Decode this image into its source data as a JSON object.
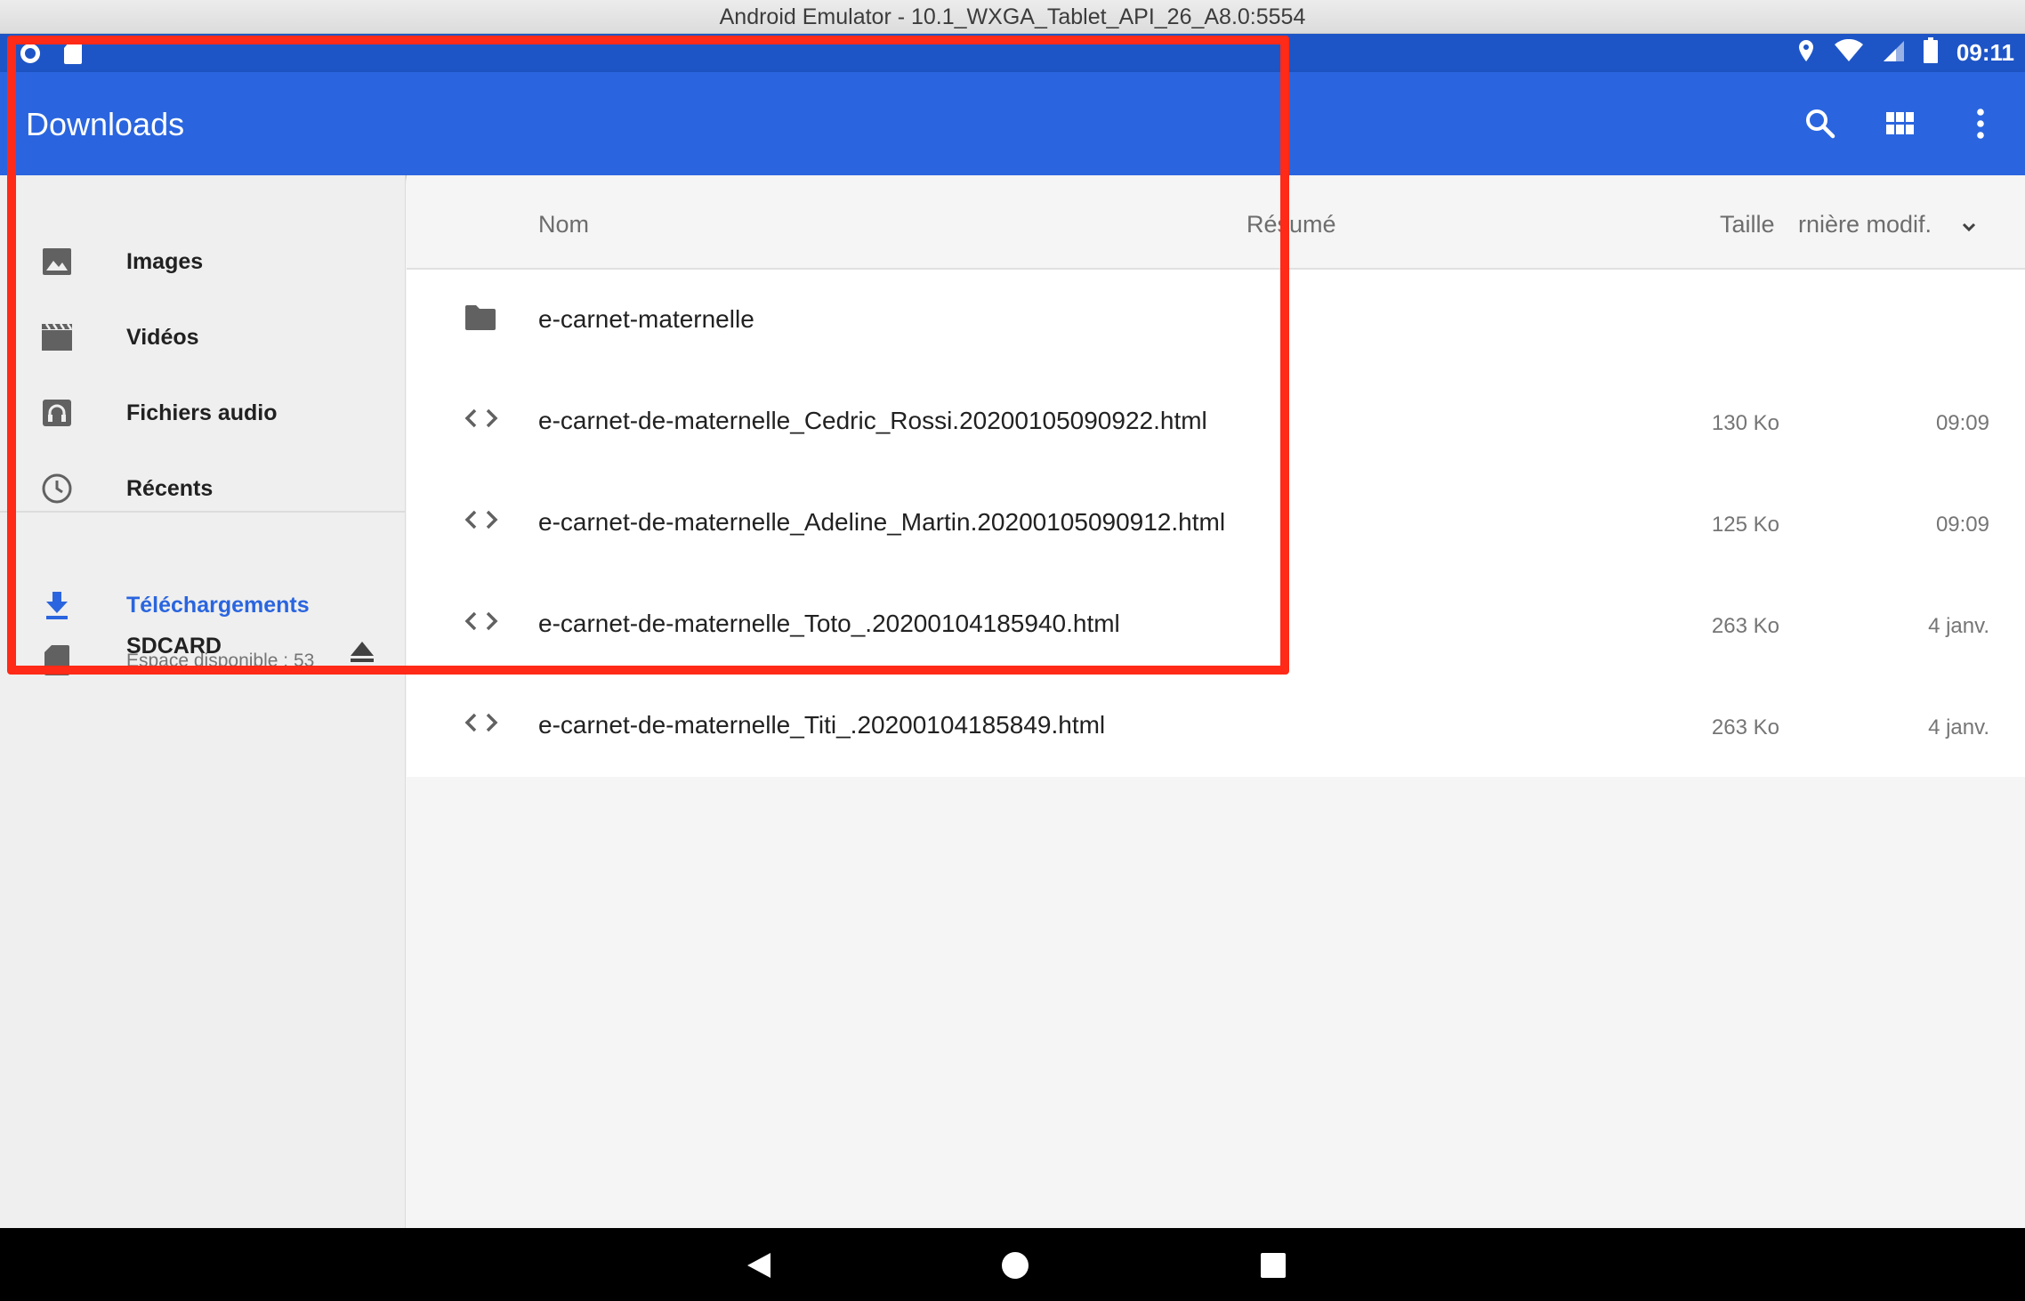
{
  "window_title": "Android Emulator - 10.1_WXGA_Tablet_API_26_A8.0:5554",
  "status_bar": {
    "time": "09:11",
    "left_icons": [
      "sync-icon",
      "sdcard-icon"
    ],
    "right_icons": [
      "location-icon",
      "wifi-icon",
      "cell-signal-icon",
      "battery-icon"
    ]
  },
  "app_bar": {
    "title": "Downloads",
    "actions": [
      "search-icon",
      "grid-view-icon",
      "more-vert-icon"
    ]
  },
  "sidebar": {
    "roots": [
      {
        "label": "Images",
        "icon": "image-icon"
      },
      {
        "label": "Vidéos",
        "icon": "video-icon"
      },
      {
        "label": "Fichiers audio",
        "icon": "headphones-icon"
      },
      {
        "label": "Récents",
        "icon": "clock-icon"
      }
    ],
    "storage": [
      {
        "label": "Téléchargements",
        "icon": "download-icon",
        "active": true
      },
      {
        "label": "SDCARD",
        "icon": "sdcard-icon",
        "subtitle": "Espace disponible : 53",
        "action_icon": "eject-icon"
      }
    ]
  },
  "columns": {
    "name": "Nom",
    "summary": "Résumé",
    "size": "Taille",
    "modified": "rnière modif.",
    "sort_icon": "chevron-down-icon"
  },
  "files": [
    {
      "name": "e-carnet-maternelle",
      "type": "folder",
      "size": "",
      "date": ""
    },
    {
      "name": "e-carnet-de-maternelle_Cedric_Rossi.20200105090922.html",
      "type": "html",
      "size": "130 Ko",
      "date": "09:09"
    },
    {
      "name": "e-carnet-de-maternelle_Adeline_Martin.20200105090912.html",
      "type": "html",
      "size": "125 Ko",
      "date": "09:09"
    },
    {
      "name": "e-carnet-de-maternelle_Toto_.20200104185940.html",
      "type": "html",
      "size": "263 Ko",
      "date": "4 janv."
    },
    {
      "name": "e-carnet-de-maternelle_Titi_.20200104185849.html",
      "type": "html",
      "size": "263 Ko",
      "date": "4 janv."
    }
  ],
  "colors": {
    "status_bar": "#1e55c6",
    "app_bar": "#2a65df",
    "accent": "#2a65df",
    "highlight_box": "#ff2a17"
  }
}
